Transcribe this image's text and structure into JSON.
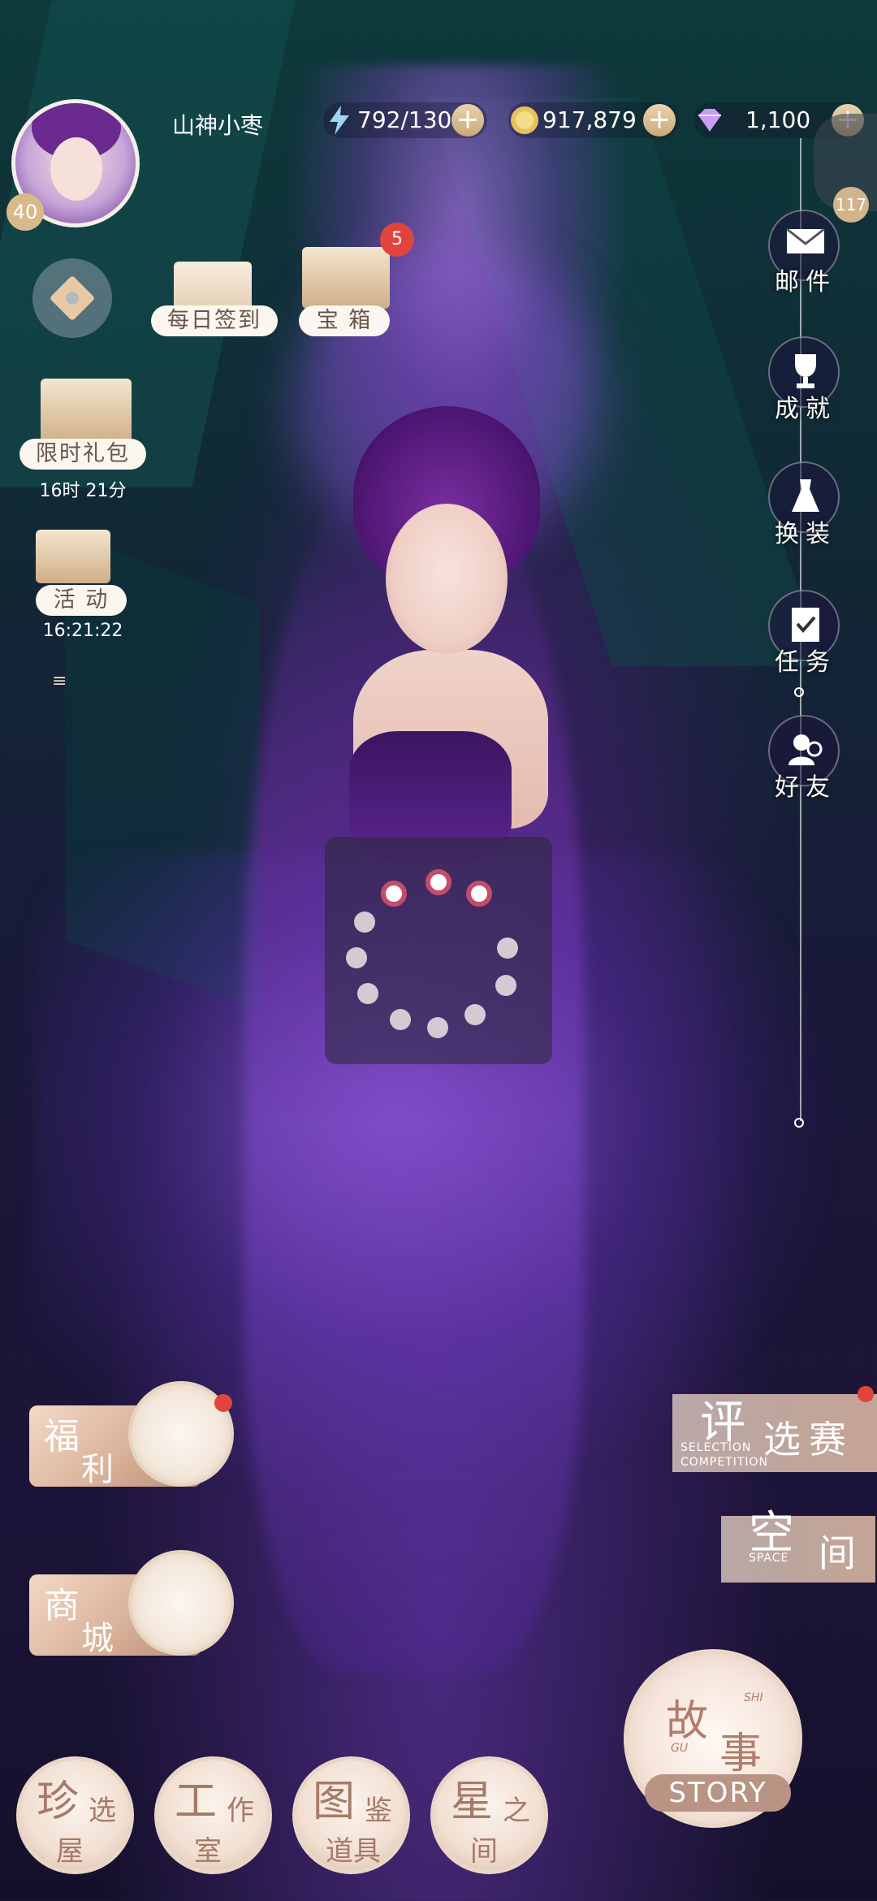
{
  "profile": {
    "name": "山神小枣",
    "level": "40"
  },
  "resources": {
    "stamina": {
      "value": "792/130",
      "icon": "lightning-icon"
    },
    "coins": {
      "value": "917,879",
      "icon": "gold-coin-icon"
    },
    "diamonds": {
      "value": "1,100",
      "icon": "diamond-icon"
    }
  },
  "corner_badge": "117",
  "left_features": {
    "daily_checkin": "每日签到",
    "treasure": "宝 箱",
    "treasure_badge": "5",
    "limited_pack": "限时礼包",
    "limited_timer": "16时 21分",
    "event": "活 动",
    "event_timer": "16:21:22"
  },
  "sidebar": [
    {
      "label": "邮件",
      "icon": "mail-icon"
    },
    {
      "label": "成就",
      "icon": "trophy-icon"
    },
    {
      "label": "换装",
      "icon": "dress-icon"
    },
    {
      "label": "任务",
      "icon": "task-clipboard-icon"
    },
    {
      "label": "好友",
      "icon": "friends-icon"
    }
  ],
  "left_buttons": {
    "welfare": {
      "c1": "福",
      "c2": "利"
    },
    "shop": {
      "c1": "商",
      "c2": "城"
    }
  },
  "right_buttons": {
    "competition": {
      "big": "评",
      "rest": "选赛",
      "en1": "SELECTION",
      "en2": "COMPETITION"
    },
    "space": {
      "big": "空",
      "rest": "间",
      "en": "SPACE"
    }
  },
  "story": {
    "c1": "故",
    "c2": "事",
    "py1": "SHI",
    "py2": "GU",
    "en": "STORY"
  },
  "bottom_nav": [
    {
      "k1": "珍",
      "k2": "选",
      "k3": "屋"
    },
    {
      "k1": "工",
      "k2": "作",
      "k3": "室"
    },
    {
      "k1": "图",
      "k2": "鉴",
      "k3": "道具"
    },
    {
      "k1": "星",
      "k2": "之",
      "k3": "间"
    }
  ],
  "colors": {
    "accent": "#d7b98a",
    "badge_red": "#e0443c",
    "panel_bg": "#1a1838"
  }
}
